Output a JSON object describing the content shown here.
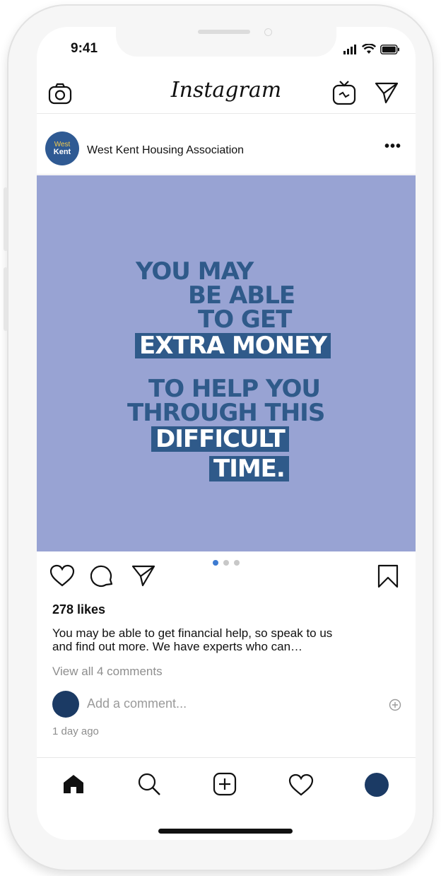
{
  "status_bar": {
    "time": "9:41"
  },
  "top_bar": {
    "title": "Instagram"
  },
  "post": {
    "account_name": "West Kent Housing Association",
    "avatar_text_top": "West",
    "avatar_text_bottom": "Kent",
    "more_icon": "more-dots-icon",
    "image_text": {
      "line1": "YOU MAY",
      "line2": "BE ABLE",
      "line3": "TO GET",
      "line4": "EXTRA MONEY",
      "line5": "TO HELP YOU",
      "line6": "THROUGH THIS",
      "line7": "DIFFICULT",
      "line8": "TIME."
    },
    "carousel": {
      "count": 3,
      "active_index": 0
    },
    "likes": "278 likes",
    "caption_line1": "You may be able to get financial help, so speak to us",
    "caption_line2": "and find out more. We have experts who can…",
    "view_comments": "View all 4 comments",
    "add_comment_placeholder": "Add a comment...",
    "time_ago": "1 day ago"
  },
  "colors": {
    "poster_bg": "#98a3d3",
    "poster_text": "#2f5a8a",
    "brand": "#2f5a93",
    "carousel_active": "#3d7bd1"
  },
  "icons": {
    "top_left": "camera-icon",
    "top_right": [
      "igtv-icon",
      "direct-message-icon"
    ],
    "actions": [
      "heart-icon",
      "comment-icon",
      "share-icon",
      "bookmark-icon"
    ],
    "tabs": [
      "home-icon",
      "search-icon",
      "new-post-icon",
      "activity-heart-icon",
      "profile-avatar"
    ]
  }
}
